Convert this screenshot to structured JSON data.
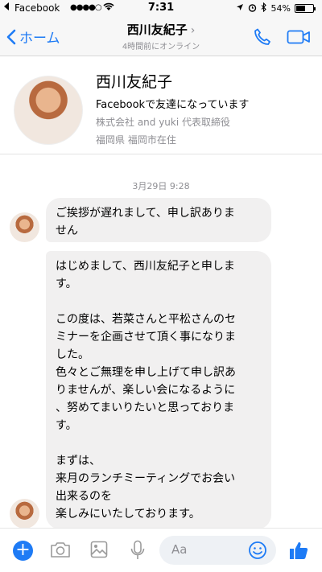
{
  "status_bar": {
    "carrier": "Facebook",
    "signal": "●●●●○",
    "time": "7:31",
    "battery": "54%"
  },
  "nav": {
    "back_label": "ホーム",
    "title": "西川友紀子",
    "subtitle": "4時間前にオンライン"
  },
  "profile": {
    "name": "西川友紀子",
    "friend_status": "Facebookで友達になっています",
    "company": "株式会社 and yuki 代表取締役",
    "location": "福岡県 福岡市在住"
  },
  "chat": {
    "timestamp": "3月29日 9:28",
    "messages": [
      {
        "text": "ご挨拶が遅れまして、申し訳ありま\nせん"
      },
      {
        "text": "はじめまして、西川友紀子と申しま\nす。\n\nこの度は、若菜さんと平松さんのセ\nミナーを企画させて頂く事になりま\nした。\n色々とご無理を申し上げて申し訳あ\nりませんが、楽しい会になるように\n、努めてまいりたいと思っておりま\nす。\n\nまずは、\n来月のランチミーティングでお会い\n出来るのを\n楽しみにいたしております。"
      }
    ]
  },
  "composer": {
    "placeholder": "Aa"
  },
  "colors": {
    "accent": "#1e7bf5",
    "bubble": "#f1f0f0",
    "muted": "#8e8e93"
  }
}
